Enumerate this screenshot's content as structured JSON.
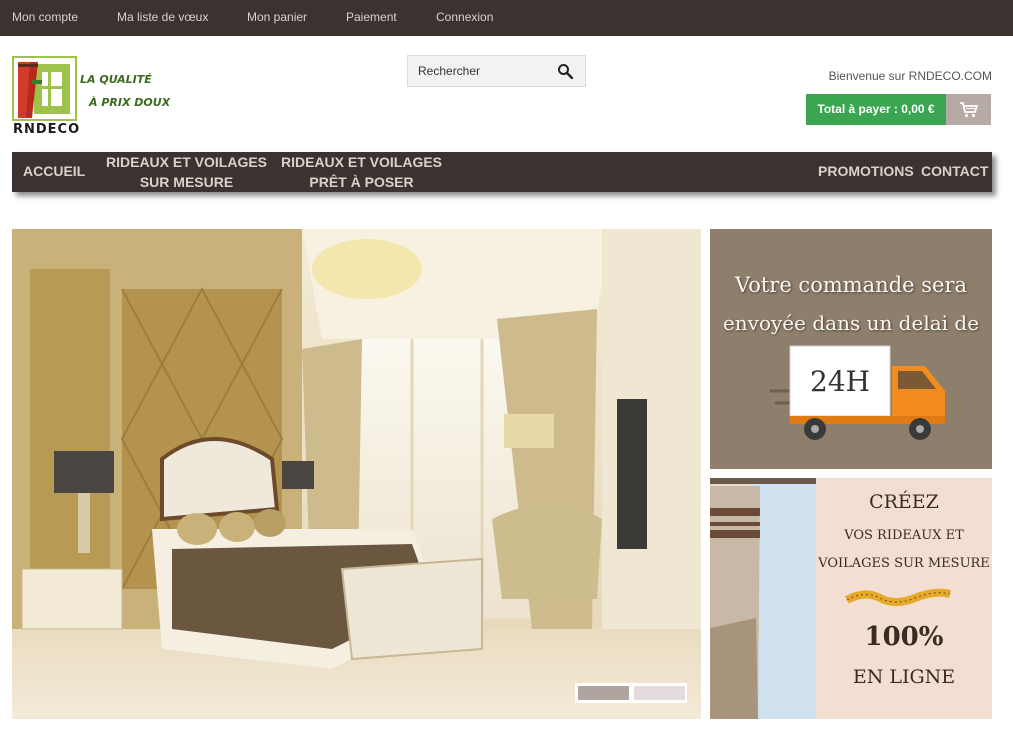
{
  "topnav": {
    "account": "Mon compte",
    "wishlist": "Ma liste de vœux",
    "cart": "Mon panier",
    "payment": "Paiement",
    "login": "Connexion"
  },
  "logo": {
    "brand": "RNDECO",
    "tagline1": "LA QUALITÉ",
    "tagline2": "À PRIX DOUX"
  },
  "search": {
    "placeholder": "Rechercher",
    "icon": "search-icon"
  },
  "welcome": "Bienvenue sur RNDECO.COM",
  "cart": {
    "total_label": "Total à payer : 0,00 €",
    "icon": "cart-icon"
  },
  "mainnav": {
    "home": "ACCUEIL",
    "custom_line1": "RIDEAUX ET VOILAGES",
    "custom_line2": "SUR MESURE",
    "ready_line1": "RIDEAUX ET VOILAGES",
    "ready_line2": "PRÊT À POSER",
    "promotions": "PROMOTIONS",
    "contact": "CONTACT"
  },
  "slider": {
    "slide_count": 2,
    "active_slide": 1
  },
  "banner_delivery": {
    "line1": "Votre commande sera",
    "line2": "envoyée dans un delai de",
    "badge": "24H"
  },
  "banner_custom": {
    "line1": "CRÉEZ",
    "line2": "VOS RIDEAUX ET",
    "line3": "VOILAGES SUR MESURE",
    "line4": "100%",
    "line5": "EN LIGNE"
  },
  "colors": {
    "topbar": "#3a3330",
    "accent_green": "#3aa651",
    "logo_green": "#9ec24a",
    "logo_red": "#d23a2a",
    "banner_brown": "#8e7f6c",
    "banner_pink": "#f3dfd1"
  }
}
